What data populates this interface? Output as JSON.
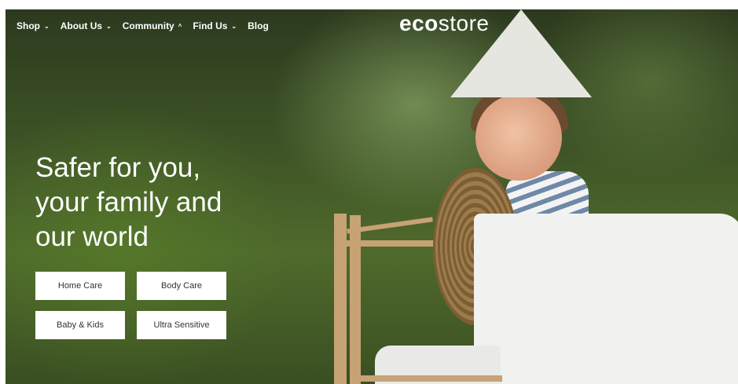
{
  "nav": {
    "items": [
      {
        "label": "Shop",
        "chevron": "⌄"
      },
      {
        "label": "About Us",
        "chevron": "⌄"
      },
      {
        "label": "Community",
        "chevron": "^"
      },
      {
        "label": "Find Us",
        "chevron": "⌄"
      },
      {
        "label": "Blog"
      }
    ]
  },
  "logo": {
    "bold": "eco",
    "light": "store"
  },
  "hero": {
    "headline_lines": [
      "Safer for you,",
      "your family and",
      "our world"
    ]
  },
  "categories": [
    {
      "label": "Home Care"
    },
    {
      "label": "Body Care"
    },
    {
      "label": "Baby & Kids"
    },
    {
      "label": "Ultra Sensitive"
    }
  ]
}
